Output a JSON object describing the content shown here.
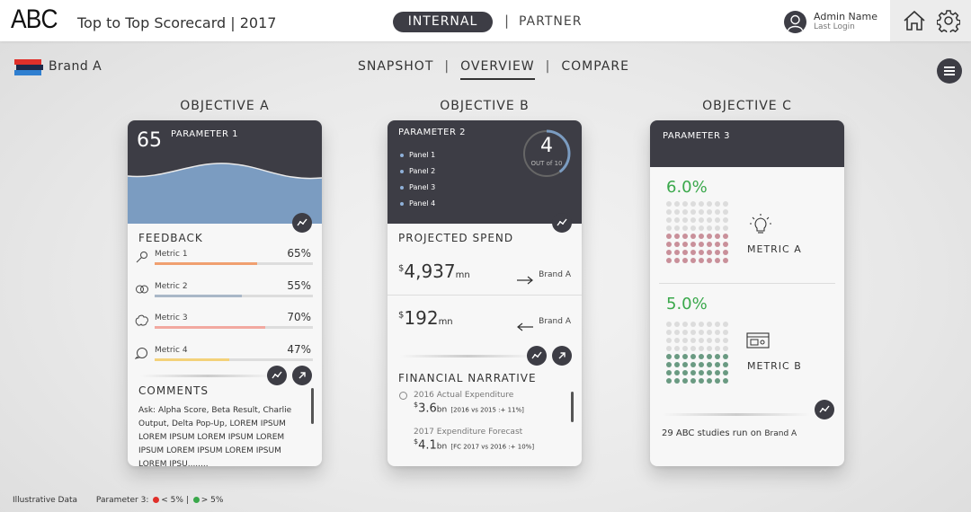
{
  "header": {
    "logo": "ABC",
    "title": "Top to Top Scorecard | 2017",
    "toggle": {
      "internal": "INTERNAL",
      "separator": "|",
      "partner": "PARTNER"
    },
    "user": {
      "name": "Admin Name",
      "sub": "Last Login"
    },
    "icons": [
      "home-icon",
      "gear-icon",
      "user-icon"
    ]
  },
  "subheader": {
    "brand": "Brand A",
    "nav": [
      "SNAPSHOT",
      "OVERVIEW",
      "COMPARE"
    ],
    "nav_sep": "|",
    "active_nav": "OVERVIEW"
  },
  "objectives": {
    "a": {
      "heading": "OBJECTIVE A",
      "value": "65",
      "param": "PARAMETER 1",
      "feedback_label": "FEEDBACK",
      "metrics": [
        {
          "name": "Metric 1",
          "value": "65%",
          "fill": 0.65,
          "color": "#f0a070"
        },
        {
          "name": "Metric 2",
          "value": "55%",
          "fill": 0.55,
          "color": "#a9b7c7"
        },
        {
          "name": "Metric 3",
          "value": "70%",
          "fill": 0.7,
          "color": "#f2a9a0"
        },
        {
          "name": "Metric 4",
          "value": "47%",
          "fill": 0.47,
          "color": "#f3d27a"
        }
      ],
      "comments_label": "COMMENTS",
      "comments": "Ask: Alpha Score, Beta Result, Charlie Output, Delta Pop-Up, LOREM IPSUM LOREM IPSUM LOREM IPSUM LOREM IPSUM LOREM IPSUM LOREM IPSUM LOREM IPSU........"
    },
    "b": {
      "heading": "OBJECTIVE B",
      "param": "PARAMETER 2",
      "panels": [
        "Panel 1",
        "Panel 2",
        "Panel 3",
        "Panel 4"
      ],
      "gauge_value": "4",
      "gauge_caption": "OUT of 10",
      "gauge_fraction": 0.4,
      "projected_label": "PROJECTED SPEND",
      "spend": [
        {
          "currency": "$",
          "amount": "4,937",
          "unit": "mn",
          "brand": "Brand A",
          "direction": "right"
        },
        {
          "currency": "$",
          "amount": "192",
          "unit": "mn",
          "brand": "Brand A",
          "direction": "left"
        }
      ],
      "narrative_label": "FINANCIAL NARRATIVE",
      "narrative": [
        {
          "title": "2016 Actual Expenditure",
          "currency": "$",
          "amount": "3.6",
          "unit": "bn",
          "note": "[2016 vs 2015 :+ 11%]"
        },
        {
          "title": "2017 Expenditure Forecast",
          "currency": "$",
          "amount": "4.1",
          "unit": "bn",
          "note": "[FC 2017 vs 2016 :+ 10%]"
        }
      ]
    },
    "c": {
      "heading": "OBJECTIVE C",
      "param": "PARAMETER 3",
      "metrics": [
        {
          "pct": "6.0%",
          "name": "METRIC A",
          "icon": "lightbulb-icon",
          "filled_rows": 4,
          "color": "#c9909a"
        },
        {
          "pct": "5.0%",
          "name": "METRIC B",
          "icon": "browser-icon",
          "filled_rows": 4,
          "color": "#6a9a82"
        }
      ],
      "footnote_prefix": "29 ABC studies run on",
      "footnote_brand": "Brand A"
    }
  },
  "footer": {
    "note": "Illustrative Data",
    "legend_label": "Parameter 3:",
    "legend": [
      {
        "color": "#e0302a",
        "text": "< 5%"
      },
      {
        "color": "#3aa84b",
        "text": "> 5%"
      }
    ],
    "legend_sep": "|"
  }
}
